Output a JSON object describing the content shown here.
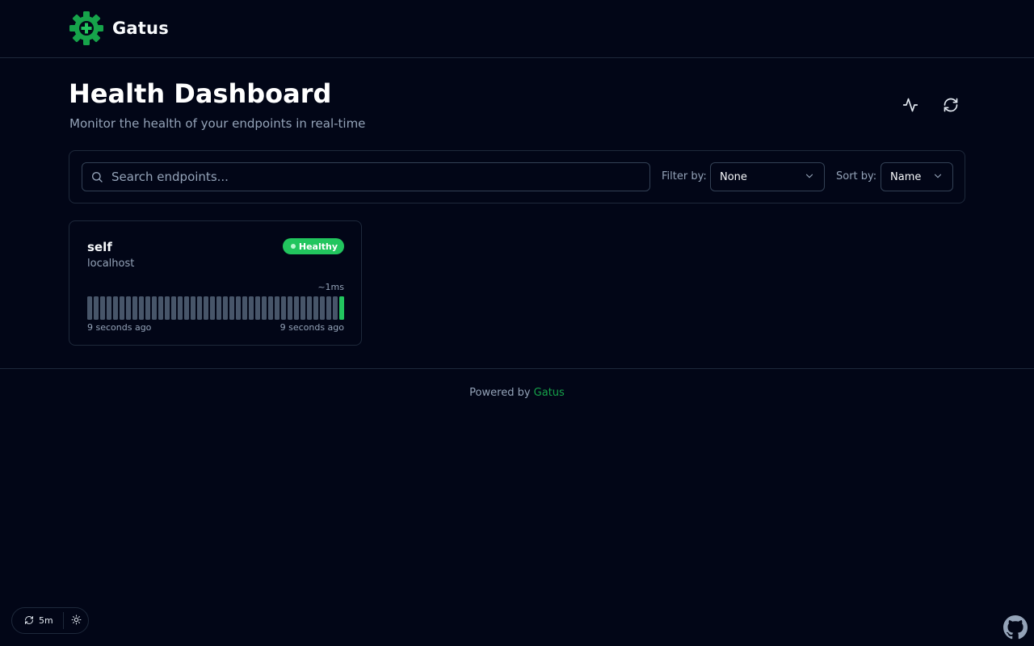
{
  "app": {
    "name": "Gatus",
    "logo_icon": "gear-plus-logo-icon",
    "brand_color": "#22c55e"
  },
  "header": {
    "title": "Health Dashboard",
    "subtitle": "Monitor the health of your endpoints in real-time",
    "actions": [
      {
        "name": "activity-icon",
        "label": ""
      },
      {
        "name": "refresh-icon",
        "label": ""
      }
    ]
  },
  "toolbar": {
    "search": {
      "placeholder": "Search endpoints...",
      "value": ""
    },
    "filter": {
      "label": "Filter by:",
      "value": "None"
    },
    "sort": {
      "label": "Sort by:",
      "value": "Name"
    }
  },
  "endpoints": [
    {
      "name": "self",
      "group": "localhost",
      "status": "Healthy",
      "status_color": "#22c55e",
      "response_time": "~1ms",
      "results_count": 40,
      "results": [
        "none",
        "none",
        "none",
        "none",
        "none",
        "none",
        "none",
        "none",
        "none",
        "none",
        "none",
        "none",
        "none",
        "none",
        "none",
        "none",
        "none",
        "none",
        "none",
        "none",
        "none",
        "none",
        "none",
        "none",
        "none",
        "none",
        "none",
        "none",
        "none",
        "none",
        "none",
        "none",
        "none",
        "none",
        "none",
        "none",
        "none",
        "none",
        "none",
        "success"
      ],
      "oldest": "9 seconds ago",
      "newest": "9 seconds ago"
    }
  ],
  "footer": {
    "prefix": "Powered by",
    "link": "Gatus"
  },
  "bottom_bar": {
    "refresh_interval": "5m",
    "theme_icon": "sun-icon"
  },
  "github_icon": "github-icon",
  "colors": {
    "background": "#020617",
    "border": "#1e293b",
    "muted": "#94a3b8",
    "healthy": "#22c55e",
    "empty_bar": "#475569"
  }
}
